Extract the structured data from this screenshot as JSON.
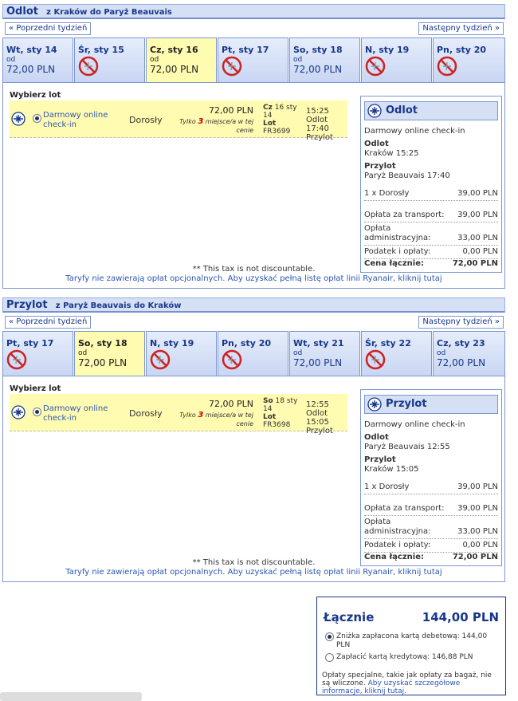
{
  "outbound": {
    "title": "Odlot",
    "route": "z Kraków do Paryż Beauvais",
    "prev_week": "« Poprzedni tydzień",
    "next_week": "Następny tydzień »",
    "tabs": [
      {
        "day": "Wt, sty 14",
        "od": "od",
        "price": "72,00 PLN",
        "available": true,
        "selected": false
      },
      {
        "day": "Śr, sty 15",
        "od": "",
        "price": "",
        "available": false,
        "selected": false
      },
      {
        "day": "Cz, sty 16",
        "od": "od",
        "price": "72,00 PLN",
        "available": true,
        "selected": true
      },
      {
        "day": "Pt, sty 17",
        "od": "",
        "price": "",
        "available": false,
        "selected": false
      },
      {
        "day": "So, sty 18",
        "od": "od",
        "price": "72,00 PLN",
        "available": true,
        "selected": false
      },
      {
        "day": "N, sty 19",
        "od": "",
        "price": "",
        "available": false,
        "selected": false
      },
      {
        "day": "Pn, sty 20",
        "od": "",
        "price": "",
        "available": false,
        "selected": false
      }
    ],
    "choose": "Wybierz lot",
    "flight": {
      "checkin": "Darmowy online check-in",
      "passenger": "Dorosły",
      "price": "72,00 PLN",
      "only_pre": "Tylko",
      "only_num": "3",
      "only_post": "miejsce/a w tej cenie",
      "day_label": "Cz",
      "day_rest": "16 sty 14",
      "lot_label": "Lot",
      "flight_no": "FR3699",
      "dep": "15:25 Odlot",
      "arr": "17:40 Przylot"
    },
    "summary": {
      "title": "Odlot",
      "checkin": "Darmowy online check-in",
      "dep_label": "Odlot",
      "dep_value": "Kraków 15:25",
      "arr_label": "Przylot",
      "arr_value": "Paryż Beauvais 17:40",
      "pax": "1 x Dorosły",
      "pax_price": "39,00 PLN",
      "transport_label": "Opłata za transport:",
      "transport_value": "39,00 PLN",
      "admin_label": "Opłata administracyjna:",
      "admin_value": "33,00 PLN",
      "tax_label": "Podatek i opłaty:",
      "tax_value": "0,00 PLN",
      "total_label": "Cena łącznie:",
      "total_value": "72,00 PLN"
    },
    "note1": "** This tax is not discountable.",
    "note2": "Taryfy nie zawierają opłat opcjonalnych. Aby uzyskać pełną listę opłat linii Ryanair, kliknij tutaj"
  },
  "inbound": {
    "title": "Przylot",
    "route": "z Paryż Beauvais do Kraków",
    "prev_week": "« Poprzedni tydzień",
    "next_week": "Następny tydzień »",
    "tabs": [
      {
        "day": "Pt, sty 17",
        "od": "",
        "price": "",
        "available": false,
        "selected": false
      },
      {
        "day": "So, sty 18",
        "od": "od",
        "price": "72,00 PLN",
        "available": true,
        "selected": true
      },
      {
        "day": "N, sty 19",
        "od": "",
        "price": "",
        "available": false,
        "selected": false
      },
      {
        "day": "Pn, sty 20",
        "od": "",
        "price": "",
        "available": false,
        "selected": false
      },
      {
        "day": "Wt, sty 21",
        "od": "od",
        "price": "72,00 PLN",
        "available": true,
        "selected": false
      },
      {
        "day": "Śr, sty 22",
        "od": "",
        "price": "",
        "available": false,
        "selected": false
      },
      {
        "day": "Cz, sty 23",
        "od": "od",
        "price": "72,00 PLN",
        "available": true,
        "selected": false
      }
    ],
    "choose": "Wybierz lot",
    "flight": {
      "checkin": "Darmowy online check-in",
      "passenger": "Dorosły",
      "price": "72,00 PLN",
      "only_pre": "Tylko",
      "only_num": "3",
      "only_post": "miejsce/a w tej cenie",
      "day_label": "So",
      "day_rest": "18 sty 14",
      "lot_label": "Lot",
      "flight_no": "FR3698",
      "dep": "12:55 Odlot",
      "arr": "15:05 Przylot"
    },
    "summary": {
      "title": "Przylot",
      "checkin": "Darmowy online check-in",
      "dep_label": "Odlot",
      "dep_value": "Paryż Beauvais 12:55",
      "arr_label": "Przylot",
      "arr_value": "Kraków 15:05",
      "pax": "1 x Dorosły",
      "pax_price": "39,00 PLN",
      "transport_label": "Opłata za transport:",
      "transport_value": "39,00 PLN",
      "admin_label": "Opłata administracyjna:",
      "admin_value": "33,00 PLN",
      "tax_label": "Podatek i opłaty:",
      "tax_value": "0,00 PLN",
      "total_label": "Cena łącznie:",
      "total_value": "72,00 PLN"
    },
    "note1": "** This tax is not discountable.",
    "note2": "Taryfy nie zawierają opłat opcjonalnych. Aby uzyskać pełną listę opłat linii Ryanair, kliknij tutaj"
  },
  "total": {
    "label": "Łącznie",
    "value": "144,00 PLN",
    "opt_debit": "Zniżka zapłacona kartą debetową: 144,00 PLN",
    "opt_credit": "Zapłacić kartą kredytową: 146,88 PLN",
    "note": "Opłaty specjalne, takie jak opłaty za bagaż, nie są wliczone.",
    "note_link": "Aby uzyskać szczegółowe informacje, kliknij tutaj."
  },
  "colors": {
    "accent": "#17378a",
    "selected_tab": "#fffbb0",
    "header_bg": "#d6e0f5",
    "unavailable": "#cc2222"
  }
}
